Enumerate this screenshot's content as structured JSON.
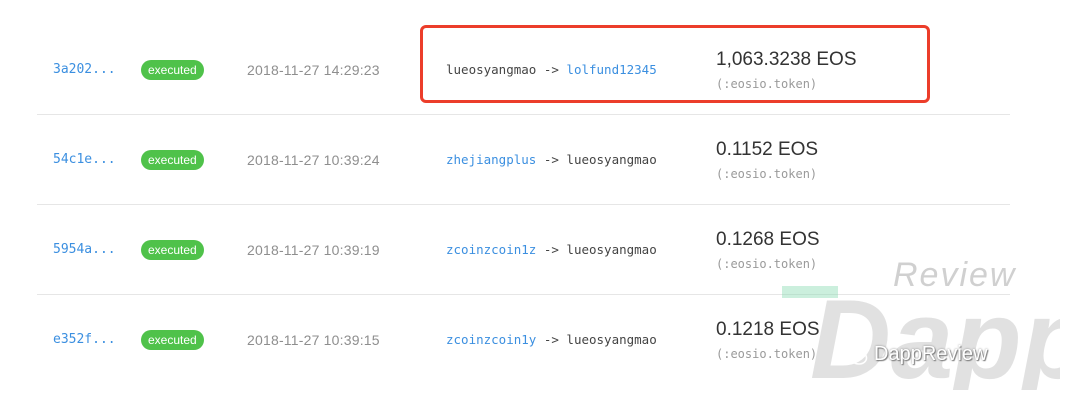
{
  "rows": [
    {
      "hash": "3a202...",
      "status": "executed",
      "time": "2018-11-27 14:29:23",
      "from": "lueosyangmao",
      "arrow": " -> ",
      "to": "lolfund12345",
      "from_link": false,
      "to_link": true,
      "amount": "1,063.3238 EOS",
      "contract": "(:eosio.token)"
    },
    {
      "hash": "54c1e...",
      "status": "executed",
      "time": "2018-11-27 10:39:24",
      "from": "zhejiangplus",
      "arrow": " -> ",
      "to": "lueosyangmao",
      "from_link": true,
      "to_link": false,
      "amount": "0.1152 EOS",
      "contract": "(:eosio.token)"
    },
    {
      "hash": "5954a...",
      "status": "executed",
      "time": "2018-11-27 10:39:19",
      "from": "zcoinzcoin1z",
      "arrow": " -> ",
      "to": "lueosyangmao",
      "from_link": true,
      "to_link": false,
      "amount": "0.1268 EOS",
      "contract": "(:eosio.token)"
    },
    {
      "hash": "e352f...",
      "status": "executed",
      "time": "2018-11-27 10:39:15",
      "from": "zcoinzcoin1y",
      "arrow": " -> ",
      "to": "lueosyangmao",
      "from_link": true,
      "to_link": false,
      "amount": "0.1218 EOS",
      "contract": "(:eosio.token)"
    }
  ],
  "watermark": {
    "review": "Review",
    "brand": "DappReview",
    "big_text": "Dapp"
  },
  "colors": {
    "link": "#3b8fe0",
    "badge": "#4fc24a",
    "highlight": "#ec3d2a"
  }
}
